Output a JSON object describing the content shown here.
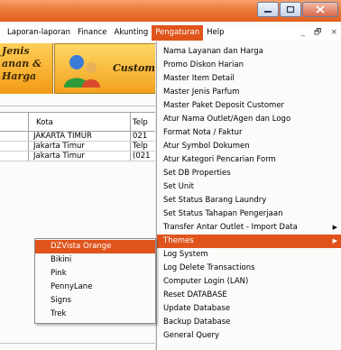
{
  "window": {
    "minimize_icon": "minimize-icon",
    "maximize_icon": "maximize-icon",
    "close_icon": "close-icon"
  },
  "menubar": {
    "items": [
      {
        "label": "Laporan-laporan"
      },
      {
        "label": "Finance"
      },
      {
        "label": "Akunting"
      },
      {
        "label": "Pengaturan",
        "active": true
      },
      {
        "label": "Help"
      }
    ],
    "mdi_minimize": "_",
    "mdi_restore": "🗗",
    "mdi_close": "×"
  },
  "banner": {
    "left_line1": "Jenis",
    "left_line2": "anan &",
    "left_line3": "Harga",
    "right_label": "Customer"
  },
  "grid": {
    "headers": [
      "Kota",
      "Telp"
    ],
    "rows": [
      [
        "JAKARTA TIMUR",
        "021"
      ],
      [
        "Jakarta Timur",
        "Telp"
      ],
      [
        "Jakarta Timur",
        "(021"
      ]
    ]
  },
  "menu": {
    "items": [
      {
        "label": "Nama Layanan dan Harga"
      },
      {
        "label": "Promo Diskon Harian"
      },
      {
        "label": "Master Item Detail"
      },
      {
        "label": "Master Jenis Parfum"
      },
      {
        "label": "Master Paket Deposit Customer"
      },
      {
        "label": "Atur Nama Outlet/Agen dan Logo"
      },
      {
        "label": "Format Nota / Faktur"
      },
      {
        "label": "Atur Symbol Dokumen"
      },
      {
        "label": "Atur Kategori Pencarian Form"
      },
      {
        "label": "Set DB Properties"
      },
      {
        "label": "Set Unit"
      },
      {
        "label": "Set Status Barang Laundry"
      },
      {
        "label": "Set Status Tahapan Pengerjaan"
      },
      {
        "label": "Transfer Antar Outlet - Import Data",
        "submenu": true
      },
      {
        "label": "Themes",
        "submenu": true,
        "highlight": true
      },
      {
        "label": "Log System"
      },
      {
        "label": "Log Delete Transactions"
      },
      {
        "label": "Computer Login (LAN)"
      },
      {
        "label": "Reset DATABASE"
      },
      {
        "label": "Update Database"
      },
      {
        "label": "Backup Database"
      },
      {
        "label": "General Query"
      }
    ],
    "arrow": "▶"
  },
  "submenu": {
    "items": [
      {
        "label": "DZVista Orange",
        "highlight": true
      },
      {
        "label": "Bikini"
      },
      {
        "label": "Pink"
      },
      {
        "label": "PennyLane"
      },
      {
        "label": "Signs"
      },
      {
        "label": "Trek"
      }
    ]
  },
  "colors": {
    "accent": "#e0541c",
    "title_bar": "#ec7a3c"
  }
}
